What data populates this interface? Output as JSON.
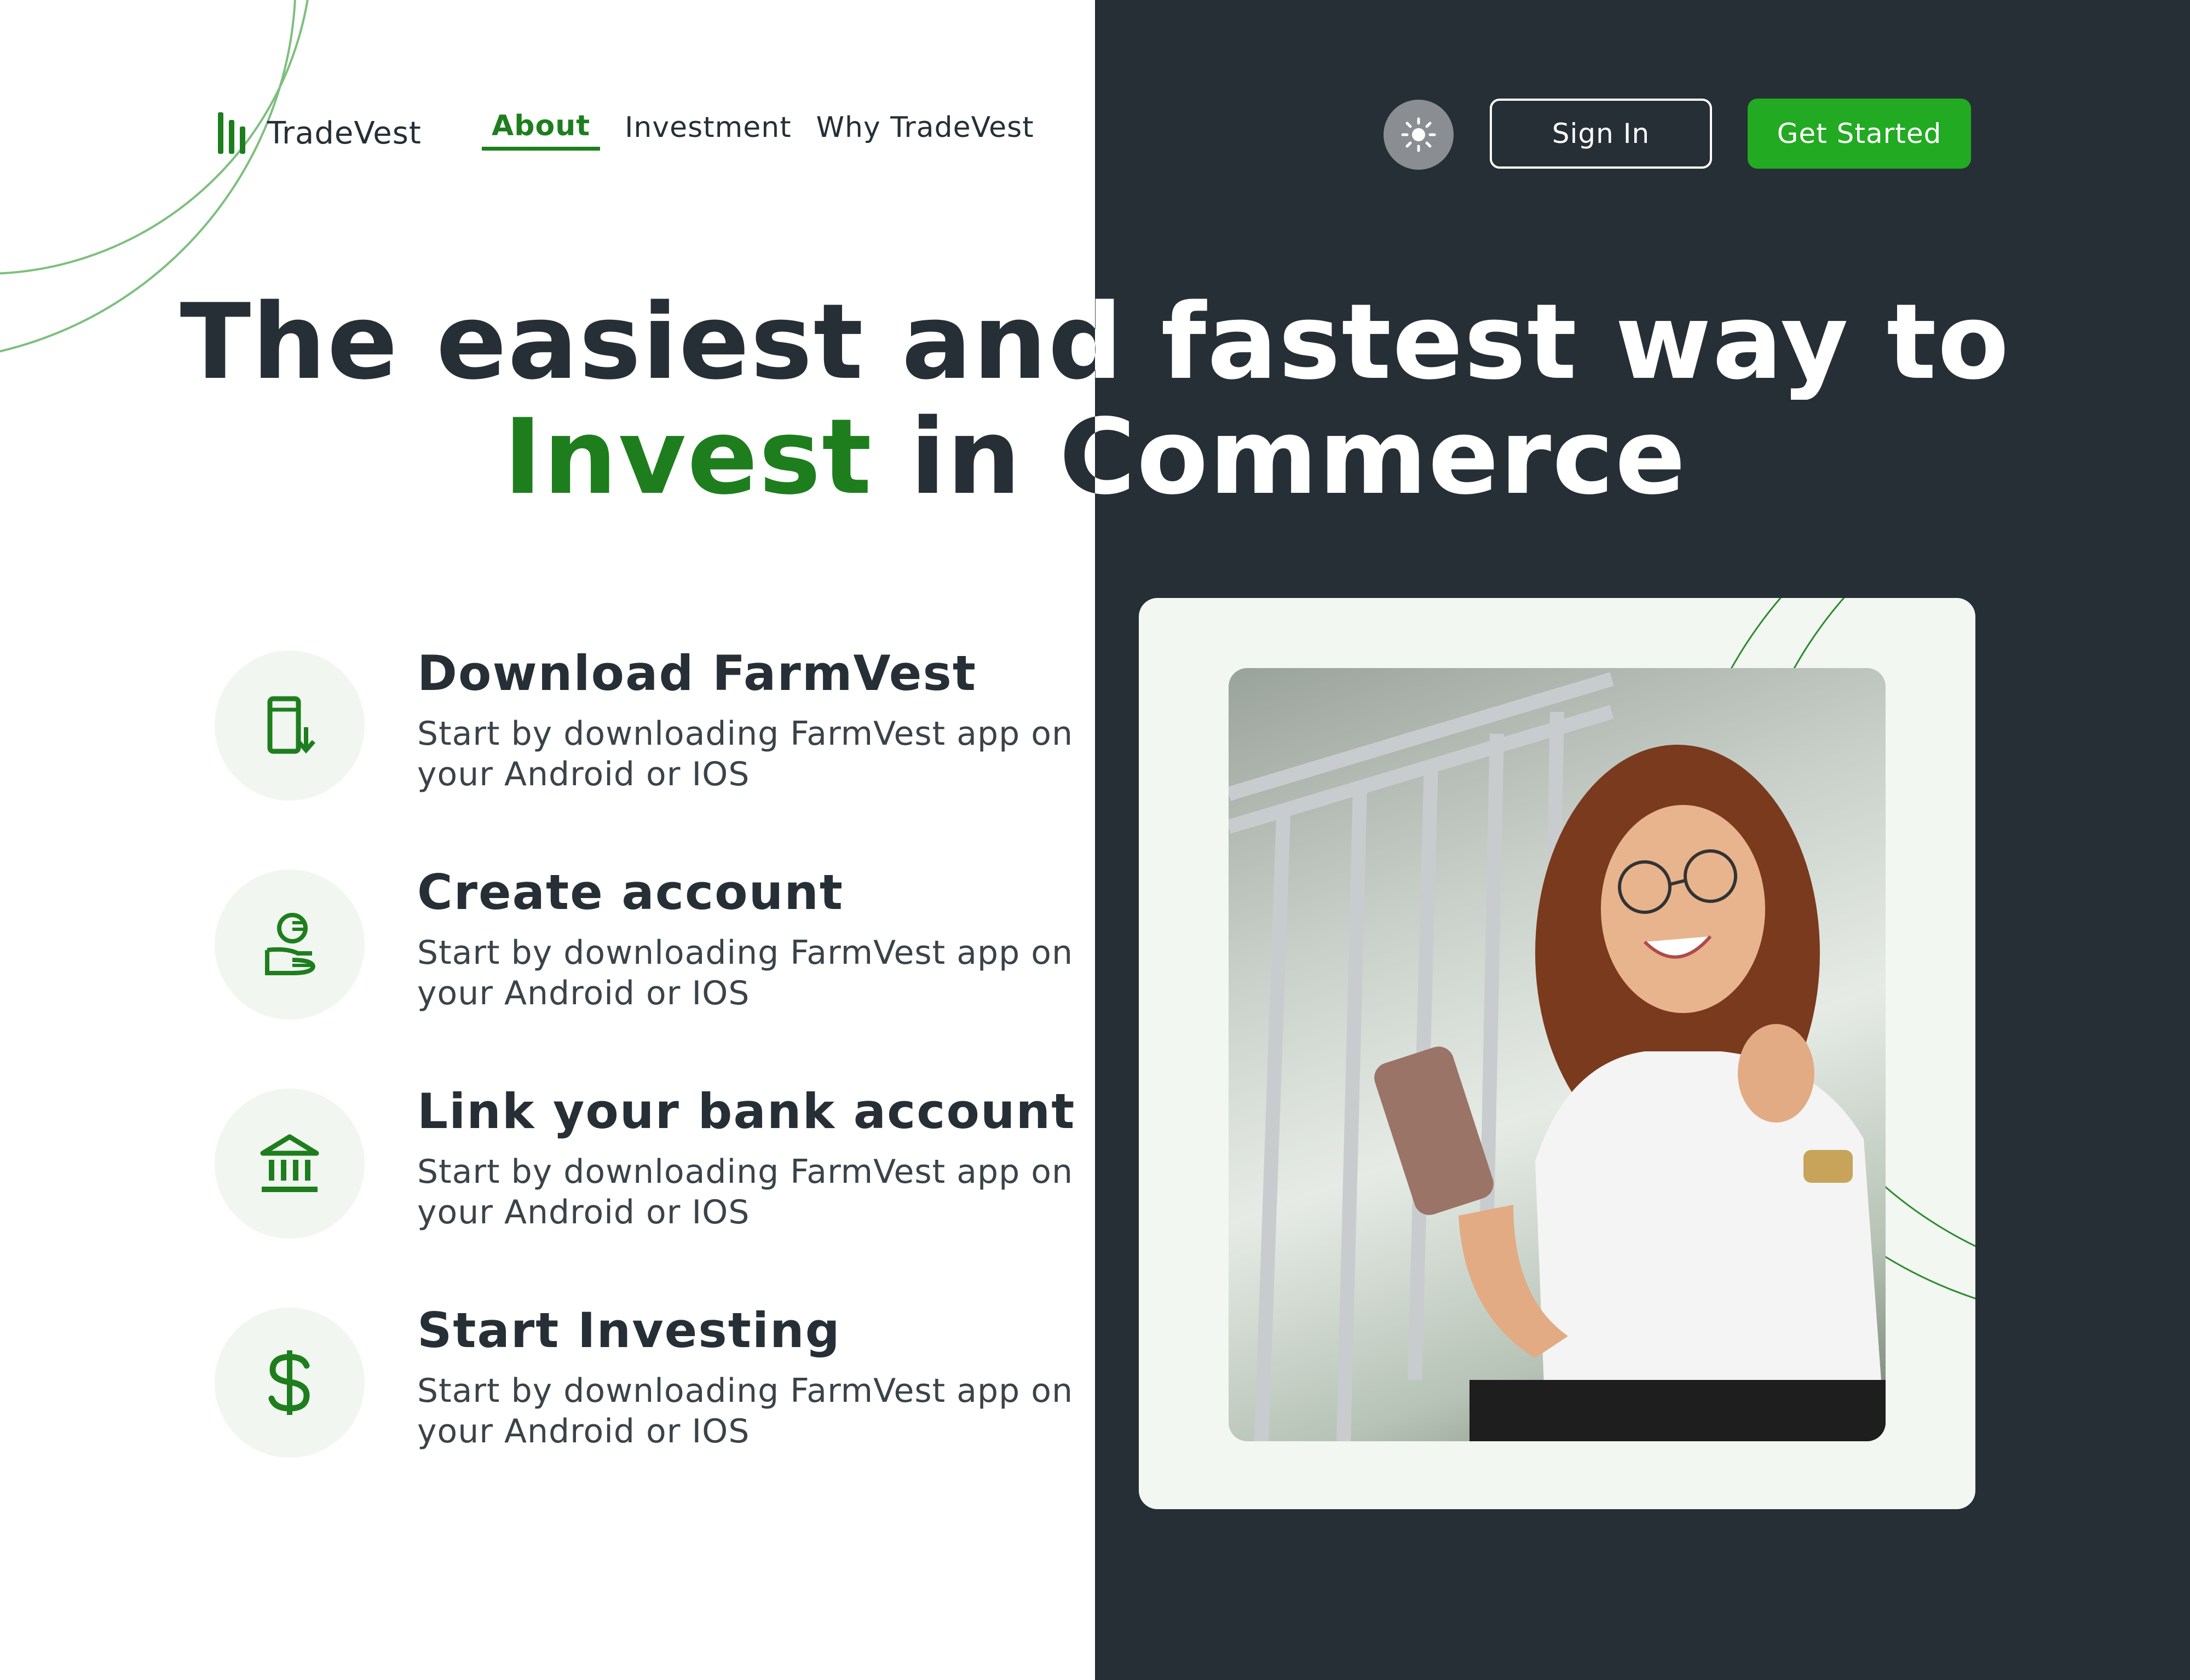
{
  "brand": {
    "name": "TradeVest",
    "accent": "#1e7e1e",
    "button_green": "#22aa22",
    "dark_bg": "#262f36"
  },
  "nav": {
    "links": [
      {
        "label": "About",
        "active": true
      },
      {
        "label": "Investment",
        "active": false
      },
      {
        "label": "Why TradeVest",
        "active": false
      }
    ],
    "theme_toggle_icon": "sun-icon",
    "sign_in": "Sign In",
    "get_started": "Get Started"
  },
  "hero": {
    "line1": "The easiest and fastest way to",
    "line2_highlight": "Invest",
    "line2_rest": " in Commerce"
  },
  "steps": [
    {
      "icon": "phone-download-icon",
      "title": "Download FarmVest",
      "desc": "Start by downloading FarmVest app on your Android or IOS"
    },
    {
      "icon": "coins-hand-icon",
      "title": "Create account",
      "desc": "Start by downloading FarmVest app on your Android or IOS"
    },
    {
      "icon": "bank-icon",
      "title": "Link your bank account",
      "desc": "Start by downloading FarmVest app on your Android or IOS"
    },
    {
      "icon": "dollar-icon",
      "title": "Start Investing",
      "desc": "Start by downloading FarmVest app on your Android or IOS"
    }
  ],
  "illustration": {
    "subject": "woman-with-phone-photo"
  }
}
